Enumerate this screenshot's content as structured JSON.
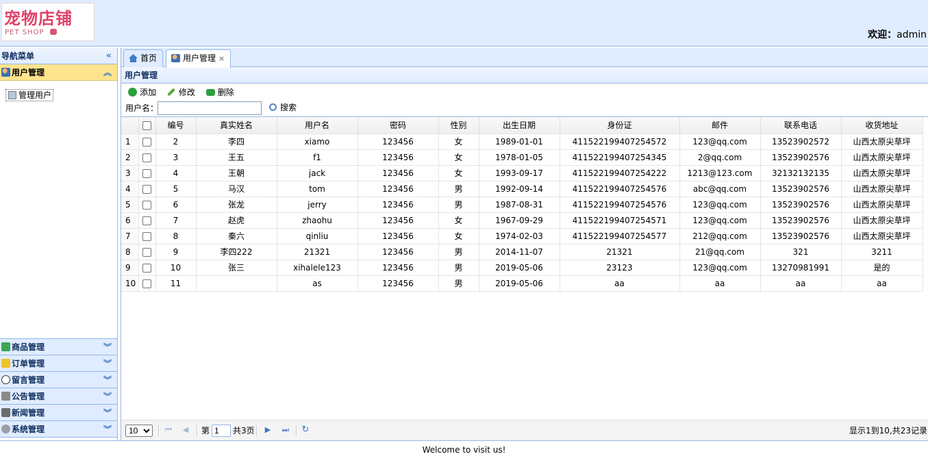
{
  "header": {
    "logo_cn": "宠物店铺",
    "logo_en": "PET SHOP",
    "welcome_label": "欢迎：",
    "welcome_user": "admin"
  },
  "nav": {
    "title": "导航菜单",
    "collapse_icon": "«",
    "sections": [
      {
        "label": "用户管理",
        "icon": "users-icon",
        "selected": true
      },
      {
        "label": "商品管理",
        "icon": "goods-icon"
      },
      {
        "label": "订单管理",
        "icon": "order-icon"
      },
      {
        "label": "留言管理",
        "icon": "message-icon"
      },
      {
        "label": "公告管理",
        "icon": "notice-icon"
      },
      {
        "label": "新闻管理",
        "icon": "news-icon"
      },
      {
        "label": "系统管理",
        "icon": "settings-icon"
      }
    ],
    "active_items": [
      {
        "label": "管理用户"
      }
    ]
  },
  "tabs": [
    {
      "label": "首页",
      "icon": "home-icon"
    },
    {
      "label": "用户管理",
      "icon": "users-icon",
      "close": "×",
      "active": true
    }
  ],
  "panel": {
    "title": "用户管理"
  },
  "toolbar": {
    "add": "添加",
    "edit": "修改",
    "delete": "删除"
  },
  "search": {
    "label": "用户名：",
    "value": "",
    "button": "搜索"
  },
  "table": {
    "columns": [
      "编号",
      "真实姓名",
      "用户名",
      "密码",
      "性别",
      "出生日期",
      "身份证",
      "邮件",
      "联系电话",
      "收货地址"
    ],
    "rows": [
      [
        "1",
        "2",
        "李四",
        "xiamo",
        "123456",
        "女",
        "1989-01-01",
        "411522199407254572",
        "123@qq.com",
        "13523902572",
        "山西太原尖草坪"
      ],
      [
        "2",
        "3",
        "王五",
        "f1",
        "123456",
        "女",
        "1978-01-05",
        "411522199407254345",
        "2@qq.com",
        "13523902576",
        "山西太原尖草坪"
      ],
      [
        "3",
        "4",
        "王朝",
        "jack",
        "123456",
        "女",
        "1993-09-17",
        "411522199407254222",
        "1213@123.com",
        "32132132135",
        "山西太原尖草坪"
      ],
      [
        "4",
        "5",
        "马汉",
        "tom",
        "123456",
        "男",
        "1992-09-14",
        "411522199407254576",
        "abc@qq.com",
        "13523902576",
        "山西太原尖草坪"
      ],
      [
        "5",
        "6",
        "张龙",
        "jerry",
        "123456",
        "男",
        "1987-08-31",
        "411522199407254576",
        "123@qq.com",
        "13523902576",
        "山西太原尖草坪"
      ],
      [
        "6",
        "7",
        "赵虎",
        "zhaohu",
        "123456",
        "女",
        "1967-09-29",
        "411522199407254571",
        "123@qq.com",
        "13523902576",
        "山西太原尖草坪"
      ],
      [
        "7",
        "8",
        "秦六",
        "qinliu",
        "123456",
        "女",
        "1974-02-03",
        "411522199407254577",
        "212@qq.com",
        "13523902576",
        "山西太原尖草坪"
      ],
      [
        "8",
        "9",
        "李四222",
        "21321",
        "123456",
        "男",
        "2014-11-07",
        "21321",
        "21@qq.com",
        "321",
        "3211"
      ],
      [
        "9",
        "10",
        "张三",
        "xihalele123",
        "123456",
        "男",
        "2019-05-06",
        "23123",
        "123@qq.com",
        "13270981991",
        "是的"
      ],
      [
        "10",
        "11",
        "",
        "as",
        "123456",
        "男",
        "2019-05-06",
        "aa",
        "aa",
        "aa",
        "aa"
      ]
    ]
  },
  "pager": {
    "page_size": "10",
    "page_label": "第",
    "page_value": "1",
    "total_pages": "共3页",
    "info": "显示1到10,共23记录"
  },
  "footer": {
    "text": "Welcome to visit us!"
  }
}
